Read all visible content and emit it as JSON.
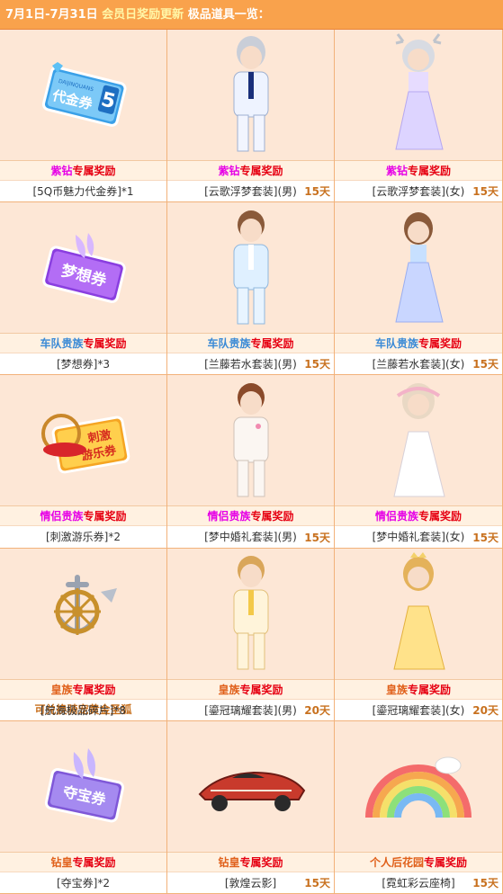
{
  "header": {
    "date": "7月1日-7月31日",
    "highlight": "会员日奖励更新",
    "title": "极品道具一览："
  },
  "colors": {
    "purple_diamond": "#e600e6",
    "team_noble": "#3a8ad6",
    "couple_noble": "#e600e6",
    "royal": "#e0601a",
    "exclusive": "#e60012",
    "days": "#c8711f"
  },
  "items": [
    {
      "tier": "紫钻",
      "tier_color": "#e600e6",
      "exclusive": "专属奖励",
      "name": "[5Q币魅力代金券]*1",
      "days": "",
      "icon": "voucher-ticket-icon"
    },
    {
      "tier": "紫钻",
      "tier_color": "#e600e6",
      "exclusive": "专属奖励",
      "name": "[云歌浮梦套装](男)",
      "days": "15天",
      "icon": "male-white-suit-avatar"
    },
    {
      "tier": "紫钻",
      "tier_color": "#e600e6",
      "exclusive": "专属奖励",
      "name": "[云歌浮梦套装](女)",
      "days": "15天",
      "icon": "female-antler-dress-avatar"
    },
    {
      "tier": "车队贵族",
      "tier_color": "#3a8ad6",
      "exclusive": "专属奖励",
      "name": "[梦想券]*3",
      "days": "",
      "icon": "dream-ticket-icon"
    },
    {
      "tier": "车队贵族",
      "tier_color": "#3a8ad6",
      "exclusive": "专属奖励",
      "name": "[兰藤若水套装](男)",
      "days": "15天",
      "icon": "male-blue-suit-avatar"
    },
    {
      "tier": "车队贵族",
      "tier_color": "#3a8ad6",
      "exclusive": "专属奖励",
      "name": "[兰藤若水套装](女)",
      "days": "15天",
      "icon": "female-blue-dress-avatar"
    },
    {
      "tier": "情侣贵族",
      "tier_color": "#e600e6",
      "exclusive": "专属奖励",
      "name": "[刺激游乐券]*2",
      "days": "",
      "icon": "amusement-ticket-icon"
    },
    {
      "tier": "情侣贵族",
      "tier_color": "#e600e6",
      "exclusive": "专属奖励",
      "name": "[梦中婚礼套装](男)",
      "days": "15天",
      "icon": "male-wedding-suit-avatar"
    },
    {
      "tier": "情侣贵族",
      "tier_color": "#e600e6",
      "exclusive": "专属奖励",
      "name": "[梦中婚礼套装](女)",
      "days": "15天",
      "icon": "female-wedding-dress-avatar"
    },
    {
      "tier": "皇族",
      "tier_color": "#e0601a",
      "exclusive": "专属奖励",
      "name": "[航海极品碎片]*8",
      "days": "",
      "note": "可兑换骑宠黄金圣狐",
      "icon": "anchor-wheel-fragment-icon"
    },
    {
      "tier": "皇族",
      "tier_color": "#e0601a",
      "exclusive": "专属奖励",
      "name": "[鎏冠璃耀套装](男)",
      "days": "20天",
      "icon": "male-gold-suit-avatar"
    },
    {
      "tier": "皇族",
      "tier_color": "#e0601a",
      "exclusive": "专属奖励",
      "name": "[鎏冠璃耀套装](女)",
      "days": "20天",
      "icon": "female-gold-dress-avatar"
    },
    {
      "tier": "钻皇",
      "tier_color": "#e0601a",
      "exclusive": "专属奖励",
      "name": "[夺宝券]*2",
      "days": "",
      "icon": "treasure-ticket-icon"
    },
    {
      "tier": "钻皇",
      "tier_color": "#e0601a",
      "exclusive": "专属奖励",
      "name": "[敦煌云影]",
      "days": "15天",
      "icon": "race-car-icon"
    },
    {
      "tier": "个人后花园",
      "tier_color": "#e0601a",
      "exclusive": "专属奖励",
      "name": "[霓虹彩云座椅]",
      "days": "15天",
      "icon": "rainbow-seat-icon"
    }
  ],
  "ticket_texts": {
    "voucher": "代金券",
    "voucher_num": "5",
    "voucher_small": "DAIJINQUANS",
    "dream": "梦想券",
    "amusement_1": "刺激",
    "amusement_2": "游乐券",
    "treasure": "夺宝券"
  }
}
